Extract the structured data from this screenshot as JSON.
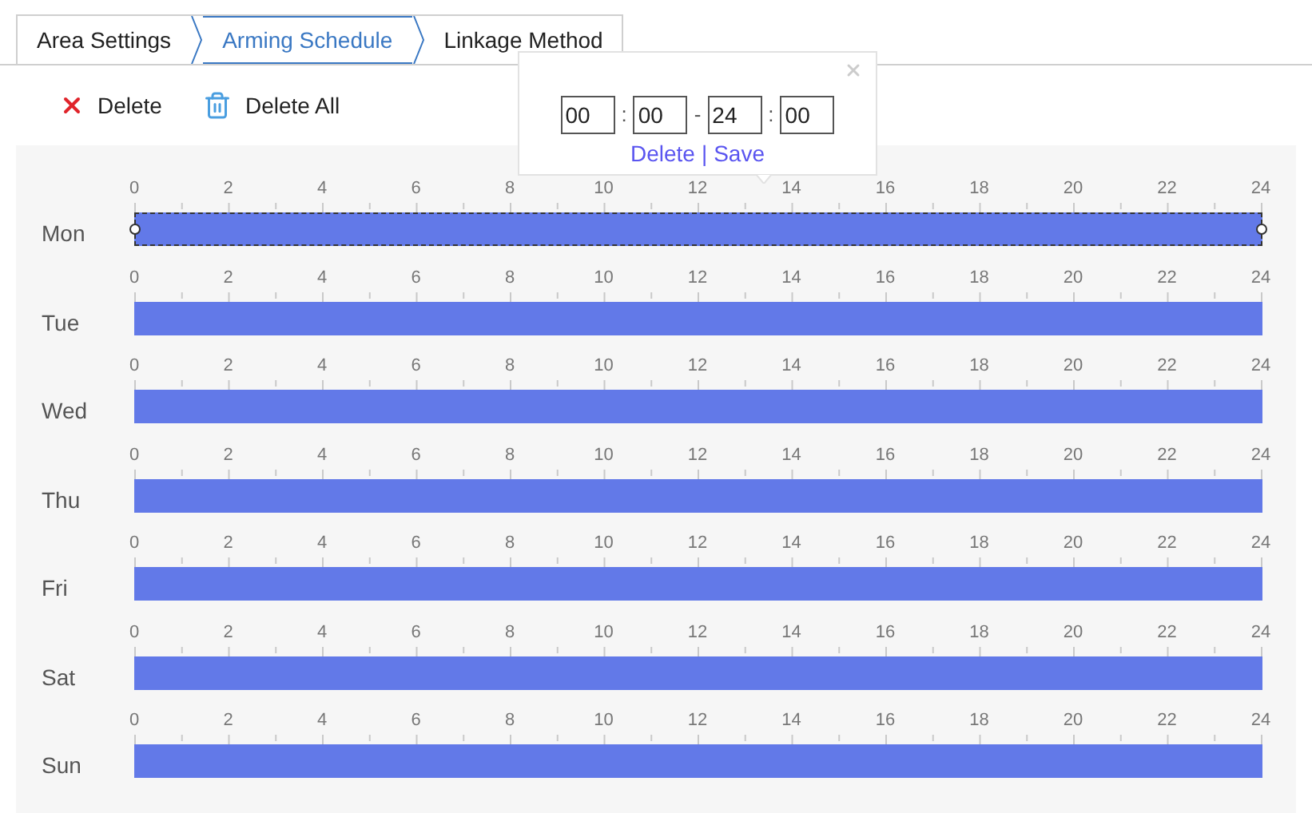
{
  "tabs": [
    {
      "label": "Area Settings",
      "selected": false
    },
    {
      "label": "Arming Schedule",
      "selected": true
    },
    {
      "label": "Linkage Method",
      "selected": false
    }
  ],
  "toolbar": [
    {
      "label": "Delete",
      "kind": "delete"
    },
    {
      "label": "Delete All",
      "kind": "delete_all"
    }
  ],
  "schedule": [
    {
      "day": "Mon",
      "ticks": [
        "0",
        "2",
        "4",
        "6",
        "8",
        "10",
        "12",
        "14",
        "16",
        "18",
        "20",
        "22",
        "24"
      ],
      "segments": [
        {
          "selected": true
        }
      ]
    },
    {
      "day": "Tue",
      "ticks": [
        "0",
        "2",
        "4",
        "6",
        "8",
        "10",
        "12",
        "14",
        "16",
        "18",
        "20",
        "22",
        "24"
      ],
      "segments": [
        {
          "selected": false
        }
      ]
    },
    {
      "day": "Wed",
      "ticks": [
        "0",
        "2",
        "4",
        "6",
        "8",
        "10",
        "12",
        "14",
        "16",
        "18",
        "20",
        "22",
        "24"
      ],
      "segments": [
        {
          "selected": false
        }
      ]
    },
    {
      "day": "Thu",
      "ticks": [
        "0",
        "2",
        "4",
        "6",
        "8",
        "10",
        "12",
        "14",
        "16",
        "18",
        "20",
        "22",
        "24"
      ],
      "segments": [
        {
          "selected": false
        }
      ]
    },
    {
      "day": "Fri",
      "ticks": [
        "0",
        "2",
        "4",
        "6",
        "8",
        "10",
        "12",
        "14",
        "16",
        "18",
        "20",
        "22",
        "24"
      ],
      "segments": [
        {
          "selected": false
        }
      ]
    },
    {
      "day": "Sat",
      "ticks": [
        "0",
        "2",
        "4",
        "6",
        "8",
        "10",
        "12",
        "14",
        "16",
        "18",
        "20",
        "22",
        "24"
      ],
      "segments": [
        {
          "selected": false
        }
      ]
    },
    {
      "day": "Sun",
      "ticks": [
        "0",
        "2",
        "4",
        "6",
        "8",
        "10",
        "12",
        "14",
        "16",
        "18",
        "20",
        "22",
        "24"
      ],
      "segments": [
        {
          "selected": false
        }
      ]
    }
  ],
  "popup": {
    "start_hour": "00",
    "start_sep": ":",
    "start_minute": "00",
    "range_sep": "-",
    "end_hour": "24",
    "end_sep": ":",
    "end_minute": "00",
    "delete_link": "Delete",
    "link_sep": "|",
    "save_link": "Save"
  }
}
